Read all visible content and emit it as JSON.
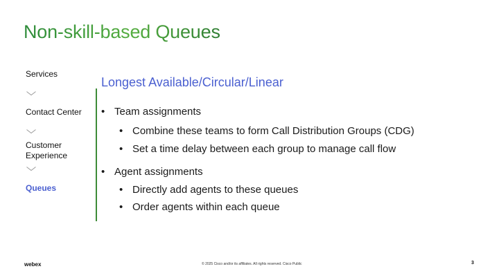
{
  "slide": {
    "title": "Non-skill-based Queues",
    "subtitle": "Longest Available/Circular/Linear",
    "nav": {
      "items": [
        {
          "label": "Services",
          "active": false
        },
        {
          "label": "Contact Center",
          "active": false
        },
        {
          "label": "Customer Experience",
          "active": false
        },
        {
          "label": "Queues",
          "active": true
        }
      ],
      "separator_icon": "chevron-down-icon"
    },
    "bullets": [
      {
        "text": "Team assignments",
        "children": [
          "Combine these teams to form Call Distribution Groups (CDG)",
          "Set a time delay between each group to manage call flow"
        ]
      },
      {
        "text": "Agent assignments",
        "children": [
          "Directly add agents to these queues",
          "Order agents within each queue"
        ]
      }
    ],
    "bullet_glyph": "•"
  },
  "footer": {
    "logo": "webex",
    "copyright": "© 2025 Cisco and/or its affiliates. All rights reserved. Cisco Public",
    "page_number": "3"
  },
  "colors": {
    "title_green": "#3d9b3a",
    "accent_blue": "#4a5fd0",
    "divider_green": "#3d8b37"
  }
}
